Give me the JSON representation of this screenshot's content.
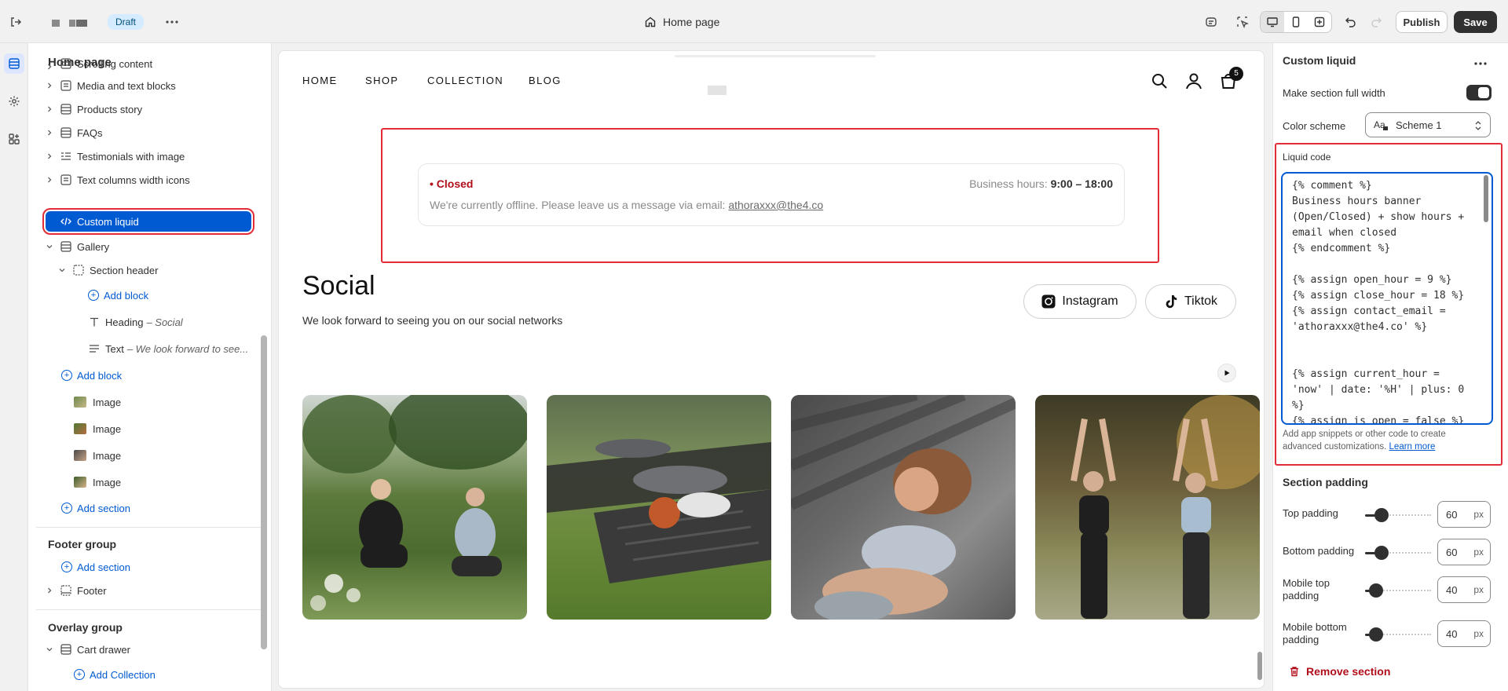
{
  "topbar": {
    "status_badge": "Draft",
    "page_title": "Home page",
    "publish_label": "Publish",
    "save_label": "Save"
  },
  "sidebar": {
    "title": "Home page",
    "items": [
      {
        "label": "Scrolling content"
      },
      {
        "label": "Media and text blocks"
      },
      {
        "label": "Products story"
      },
      {
        "label": "FAQs"
      },
      {
        "label": "Testimonials with image"
      },
      {
        "label": "Text columns width icons"
      },
      {
        "label": "Custom liquid"
      },
      {
        "label": "Gallery"
      }
    ],
    "gallery": {
      "section_header": "Section header",
      "add_block_inner": "Add block",
      "heading_label": "Heading",
      "heading_value": "– Social",
      "text_label": "Text",
      "text_value": "– We look forward to see...",
      "add_block": "Add block",
      "images": [
        "Image",
        "Image",
        "Image",
        "Image"
      ]
    },
    "add_section": "Add section",
    "footer_group": {
      "title": "Footer group",
      "add_section": "Add section",
      "footer": "Footer"
    },
    "overlay_group": {
      "title": "Overlay group",
      "cart_drawer": "Cart drawer",
      "add_collection": "Add Collection"
    }
  },
  "preview": {
    "nav": [
      "HOME",
      "SHOP",
      "COLLECTION",
      "BLOG"
    ],
    "cart_count": "5",
    "hours": {
      "status": "Closed",
      "hours_prefix": "Business hours:",
      "hours_value": "9:00 – 18:00",
      "message": "We're currently offline. Please leave us a message via email:",
      "email": "athoraxxx@the4.co"
    },
    "social": {
      "title": "Social",
      "subtitle": "We look forward to seeing you on our social networks",
      "instagram": "Instagram",
      "tiktok": "Tiktok"
    }
  },
  "rpanel": {
    "title": "Custom liquid",
    "full_width_label": "Make section full width",
    "full_width_on": true,
    "color_scheme_label": "Color scheme",
    "color_scheme_value": "Scheme 1",
    "liquid_label": "Liquid code",
    "liquid_code": "{% comment %}\nBusiness hours banner (Open/Closed) + show hours + email when closed\n{% endcomment %}\n\n{% assign open_hour = 9 %}\n{% assign close_hour = 18 %}\n{% assign contact_email = 'athoraxxx@the4.co' %}\n\n\n{% assign current_hour = 'now' | date: '%H' | plus: 0 %}\n{% assign is_open = false %}\n{% if current_hour >=",
    "help_text": "Add app snippets or other code to create advanced customizations.",
    "learn_more": "Learn more",
    "padding_title": "Section padding",
    "paddings": [
      {
        "label": "Top padding",
        "value": "60",
        "unit": "px",
        "fraction": 0.25
      },
      {
        "label": "Bottom padding",
        "value": "60",
        "unit": "px",
        "fraction": 0.25
      },
      {
        "label": "Mobile top padding",
        "value": "40",
        "unit": "px",
        "fraction": 0.17
      },
      {
        "label": "Mobile bottom padding",
        "value": "40",
        "unit": "px",
        "fraction": 0.17
      }
    ],
    "remove_label": "Remove section"
  },
  "colors": {
    "accent": "#005bd3",
    "highlight": "#e22c38",
    "closed_red": "#b10e1c",
    "dark": "#303030"
  }
}
